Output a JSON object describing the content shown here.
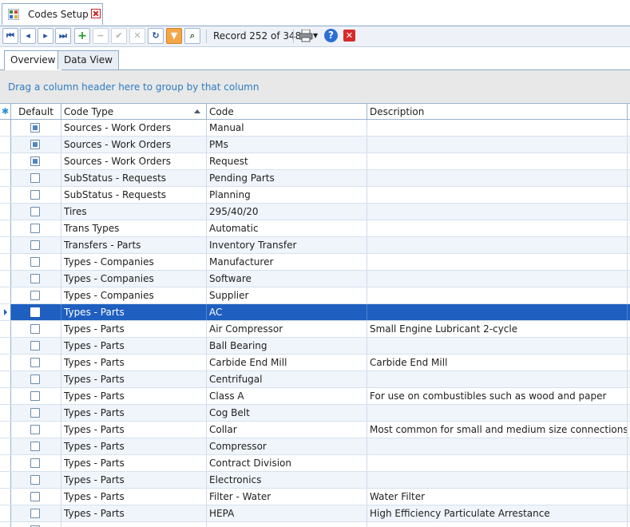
{
  "doc_tab": {
    "title": "Codes Setup"
  },
  "toolbar": {
    "record_label": "Record 252 of 348",
    "buttons": [
      "first-record",
      "prev-record",
      "next-record",
      "last-record",
      "add",
      "remove",
      "accept",
      "cancel",
      "refresh",
      "filter",
      "find"
    ]
  },
  "view_tabs": [
    "Overview",
    "Data View"
  ],
  "group_panel": {
    "hint": "Drag a column header here to group by that column"
  },
  "grid": {
    "columns": [
      "Default",
      "Code Type",
      "Code",
      "Description"
    ],
    "sorted_column": "Code Type",
    "sort_direction": "ascending",
    "selected_row": 11,
    "rows": [
      {
        "default": true,
        "code_type": "Sources - Work Orders",
        "code": "Manual",
        "description": ""
      },
      {
        "default": true,
        "code_type": "Sources - Work Orders",
        "code": "PMs",
        "description": ""
      },
      {
        "default": true,
        "code_type": "Sources - Work Orders",
        "code": "Request",
        "description": ""
      },
      {
        "default": false,
        "code_type": "SubStatus - Requests",
        "code": "Pending Parts",
        "description": ""
      },
      {
        "default": false,
        "code_type": "SubStatus - Requests",
        "code": "Planning",
        "description": ""
      },
      {
        "default": false,
        "code_type": "Tires",
        "code": "295/40/20",
        "description": ""
      },
      {
        "default": false,
        "code_type": "Trans Types",
        "code": "Automatic",
        "description": ""
      },
      {
        "default": false,
        "code_type": "Transfers - Parts",
        "code": "Inventory Transfer",
        "description": ""
      },
      {
        "default": false,
        "code_type": "Types - Companies",
        "code": "Manufacturer",
        "description": ""
      },
      {
        "default": false,
        "code_type": "Types - Companies",
        "code": "Software",
        "description": ""
      },
      {
        "default": false,
        "code_type": "Types - Companies",
        "code": "Supplier",
        "description": ""
      },
      {
        "default": false,
        "code_type": "Types - Parts",
        "code": "AC",
        "description": ""
      },
      {
        "default": false,
        "code_type": "Types - Parts",
        "code": "Air Compressor",
        "description": "Small Engine Lubricant 2-cycle"
      },
      {
        "default": false,
        "code_type": "Types - Parts",
        "code": "Ball Bearing",
        "description": ""
      },
      {
        "default": false,
        "code_type": "Types - Parts",
        "code": "Carbide End Mill",
        "description": "Carbide End Mill"
      },
      {
        "default": false,
        "code_type": "Types - Parts",
        "code": "Centrifugal",
        "description": ""
      },
      {
        "default": false,
        "code_type": "Types - Parts",
        "code": "Class A",
        "description": "For use on combustibles such as wood and paper"
      },
      {
        "default": false,
        "code_type": "Types - Parts",
        "code": "Cog Belt",
        "description": ""
      },
      {
        "default": false,
        "code_type": "Types - Parts",
        "code": "Collar",
        "description": "Most common for small and medium size connections"
      },
      {
        "default": false,
        "code_type": "Types - Parts",
        "code": "Compressor",
        "description": ""
      },
      {
        "default": false,
        "code_type": "Types - Parts",
        "code": "Contract Division",
        "description": ""
      },
      {
        "default": false,
        "code_type": "Types - Parts",
        "code": "Electronics",
        "description": ""
      },
      {
        "default": false,
        "code_type": "Types - Parts",
        "code": "Filter - Water",
        "description": "Water Filter"
      },
      {
        "default": false,
        "code_type": "Types - Parts",
        "code": "HEPA",
        "description": "High Efficiency Particulate Arrestance"
      },
      {
        "default": false,
        "code_type": "",
        "code": "",
        "description": ""
      }
    ]
  }
}
